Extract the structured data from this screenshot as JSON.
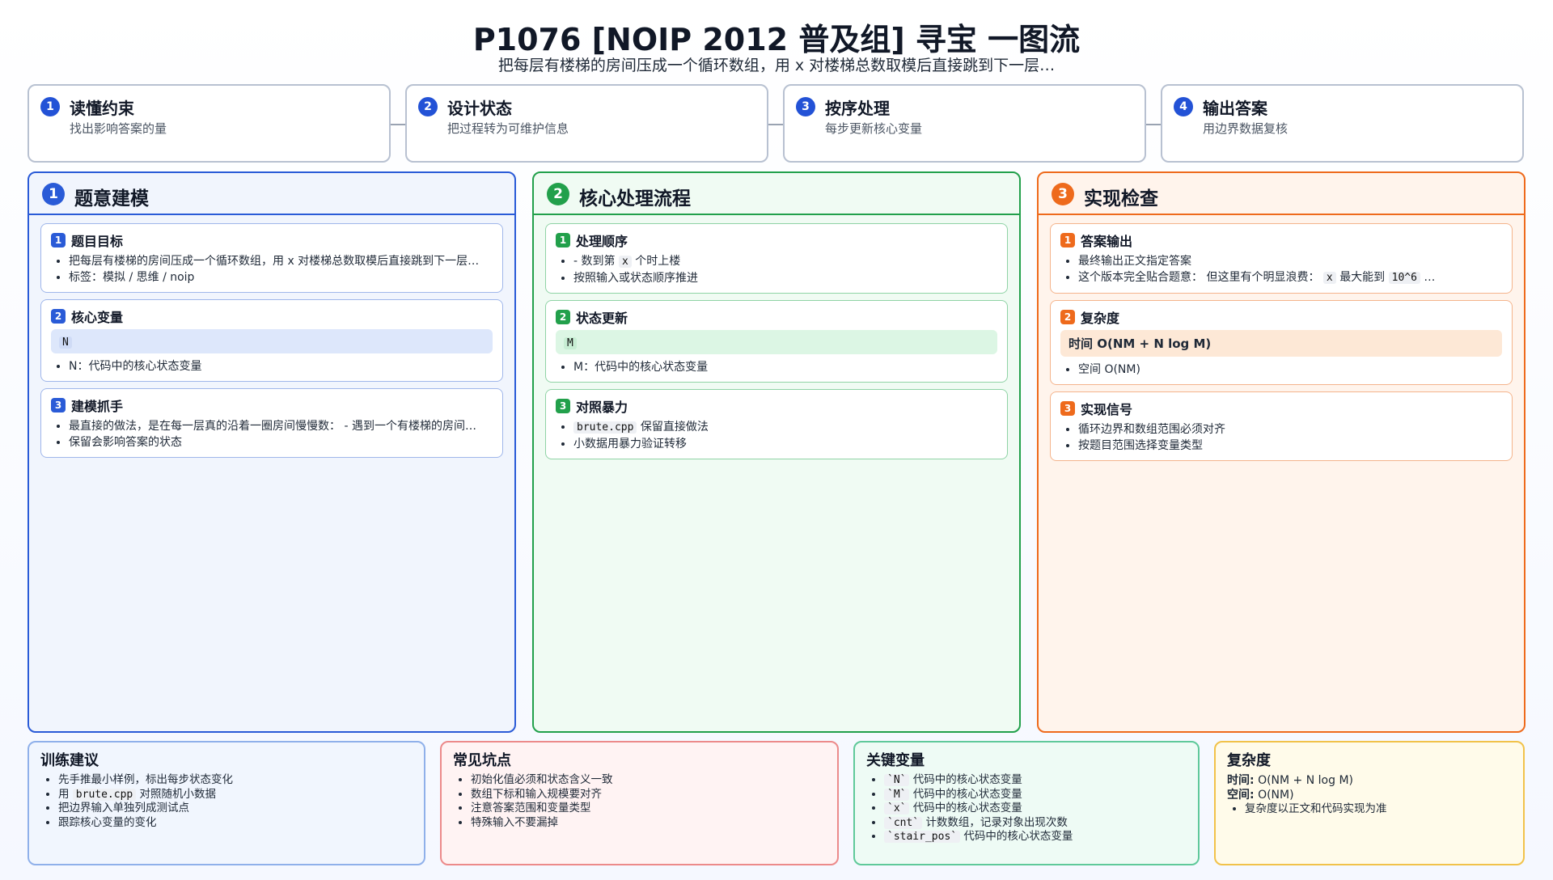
{
  "title": "P1076 [NOIP 2012 普及组] 寻宝 一图流",
  "subtitle": "把每层有楼梯的房间压成一个循环数组，用 x 对楼梯总数取模后直接跳到下一层…",
  "colors": {
    "blue": "#2a5bd7",
    "green": "#22a04b",
    "orange": "#ee6a1c",
    "red": "#e05a5a"
  },
  "steps": [
    {
      "num": "1",
      "title": "读懂约束",
      "desc": "找出影响答案的量"
    },
    {
      "num": "2",
      "title": "设计状态",
      "desc": "把过程转为可维护信息"
    },
    {
      "num": "3",
      "title": "按序处理",
      "desc": "每步更新核心变量"
    },
    {
      "num": "4",
      "title": "输出答案",
      "desc": "用边界数据复核"
    }
  ],
  "columns": [
    {
      "num": "1",
      "title": "题意建模",
      "cards": [
        {
          "num": "1",
          "title": "题目目标",
          "bullets": [
            "把每层有楼梯的房间压成一个循环数组，用 x 对楼梯总数取模后直接跳到下一层…",
            "标签：模拟 / 思维 / noip"
          ]
        },
        {
          "num": "2",
          "title": "核心变量",
          "code": "N",
          "bullets": [
            "N：代码中的核心状态变量"
          ]
        },
        {
          "num": "3",
          "title": "建模抓手",
          "bullets": [
            "最直接的做法，是在每一层真的沿着一圈房间慢慢数： - 遇到一个有楼梯的房间…",
            "保留会影响答案的状态"
          ]
        }
      ]
    },
    {
      "num": "2",
      "title": "核心处理流程",
      "cards": [
        {
          "num": "1",
          "title": "处理顺序",
          "b1_pre": "- 数到第",
          "b1_code": "x",
          "b1_post": "个时上楼",
          "b2": "按照输入或状态顺序推进"
        },
        {
          "num": "2",
          "title": "状态更新",
          "code": "M",
          "bullets": [
            "M：代码中的核心状态变量"
          ]
        },
        {
          "num": "3",
          "title": "对照暴力",
          "b1_code": "brute.cpp",
          "b1_post": "保留直接做法",
          "b2": "小数据用暴力验证转移"
        }
      ]
    },
    {
      "num": "3",
      "title": "实现检查",
      "cards": [
        {
          "num": "1",
          "title": "答案输出",
          "b1": "最终输出正文指定答案",
          "b2_pre": "这个版本完全贴合题意： 但这里有个明显浪费：",
          "b2_code1": "x",
          "b2_mid": "最大能到",
          "b2_code2": "10^6",
          "b2_post": "…"
        },
        {
          "num": "2",
          "title": "复杂度",
          "hl": "时间 O(NM + N log M)",
          "bullets": [
            "空间 O(NM)"
          ]
        },
        {
          "num": "3",
          "title": "实现信号",
          "bullets": [
            "循环边界和数组范围必须对齐",
            "按题目范围选择变量类型"
          ]
        }
      ]
    }
  ],
  "bottom": {
    "training": {
      "title": "训练建议",
      "b1": "先手推最小样例，标出每步状态变化",
      "b2_pre": "用",
      "b2_code": "brute.cpp",
      "b2_post": "对照随机小数据",
      "b3": "把边界输入单独列成测试点",
      "b4": "跟踪核心变量的变化"
    },
    "pitfalls": {
      "title": "常见坑点",
      "bullets": [
        "初始化值必须和状态含义一致",
        "数组下标和输入规模要对齐",
        "注意答案范围和变量类型",
        "特殊输入不要漏掉"
      ]
    },
    "keyvars": {
      "title": "关键变量",
      "items": [
        {
          "code": "`N`",
          "text": "代码中的核心状态变量"
        },
        {
          "code": "`M`",
          "text": "代码中的核心状态变量"
        },
        {
          "code": "`x`",
          "text": "代码中的核心状态变量"
        },
        {
          "code": "`cnt`",
          "text": "计数数组，记录对象出现次数"
        },
        {
          "code": "`stair_pos`",
          "text": "代码中的核心状态变量"
        }
      ]
    },
    "complexity": {
      "title": "复杂度",
      "time_label": "时间:",
      "time": "O(NM + N log M)",
      "space_label": "空间:",
      "space": "O(NM)",
      "note": "复杂度以正文和代码实现为准"
    }
  }
}
